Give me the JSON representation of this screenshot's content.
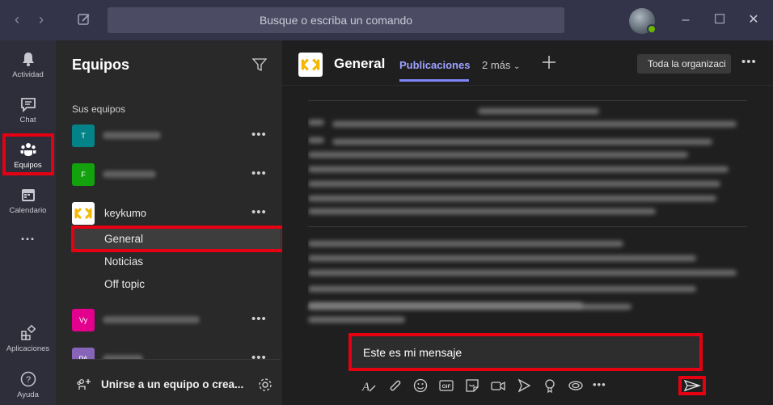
{
  "titlebar": {
    "search_placeholder": "Busque o escriba un comando"
  },
  "rail": {
    "items": [
      {
        "label": "Actividad",
        "icon": "bell-icon"
      },
      {
        "label": "Chat",
        "icon": "chat-icon"
      },
      {
        "label": "Equipos",
        "icon": "teams-icon"
      },
      {
        "label": "Calendario",
        "icon": "calendar-icon"
      },
      {
        "label": "···",
        "icon": "more-icon"
      },
      {
        "label": "Aplicaciones",
        "icon": "apps-icon"
      },
      {
        "label": "Ayuda",
        "icon": "help-icon"
      }
    ],
    "active_index": 2
  },
  "panel": {
    "title": "Equipos",
    "section_label": "Sus equipos",
    "teams": [
      {
        "initials": "T",
        "color": "#038387"
      },
      {
        "initials": "F",
        "color": "#13a10e"
      },
      {
        "initials": "",
        "name": "keykumo",
        "color": "#ffffff"
      },
      {
        "initials": "Vy",
        "color": "#e3008c"
      },
      {
        "initials": "PA",
        "color": "#8764b8"
      }
    ],
    "channels": [
      "General",
      "Noticias",
      "Off topic"
    ],
    "active_channel": "General",
    "join_label": "Unirse a un equipo o crea..."
  },
  "channel": {
    "title": "General",
    "tabs": [
      "Publicaciones",
      "2 más"
    ],
    "org_button": "Toda la organizaci",
    "compose_text": "Este es mi mensaje"
  },
  "colors": {
    "accent": "#7f85f5",
    "highlight": "#e50012",
    "logo_yellow": "#f5b800"
  }
}
